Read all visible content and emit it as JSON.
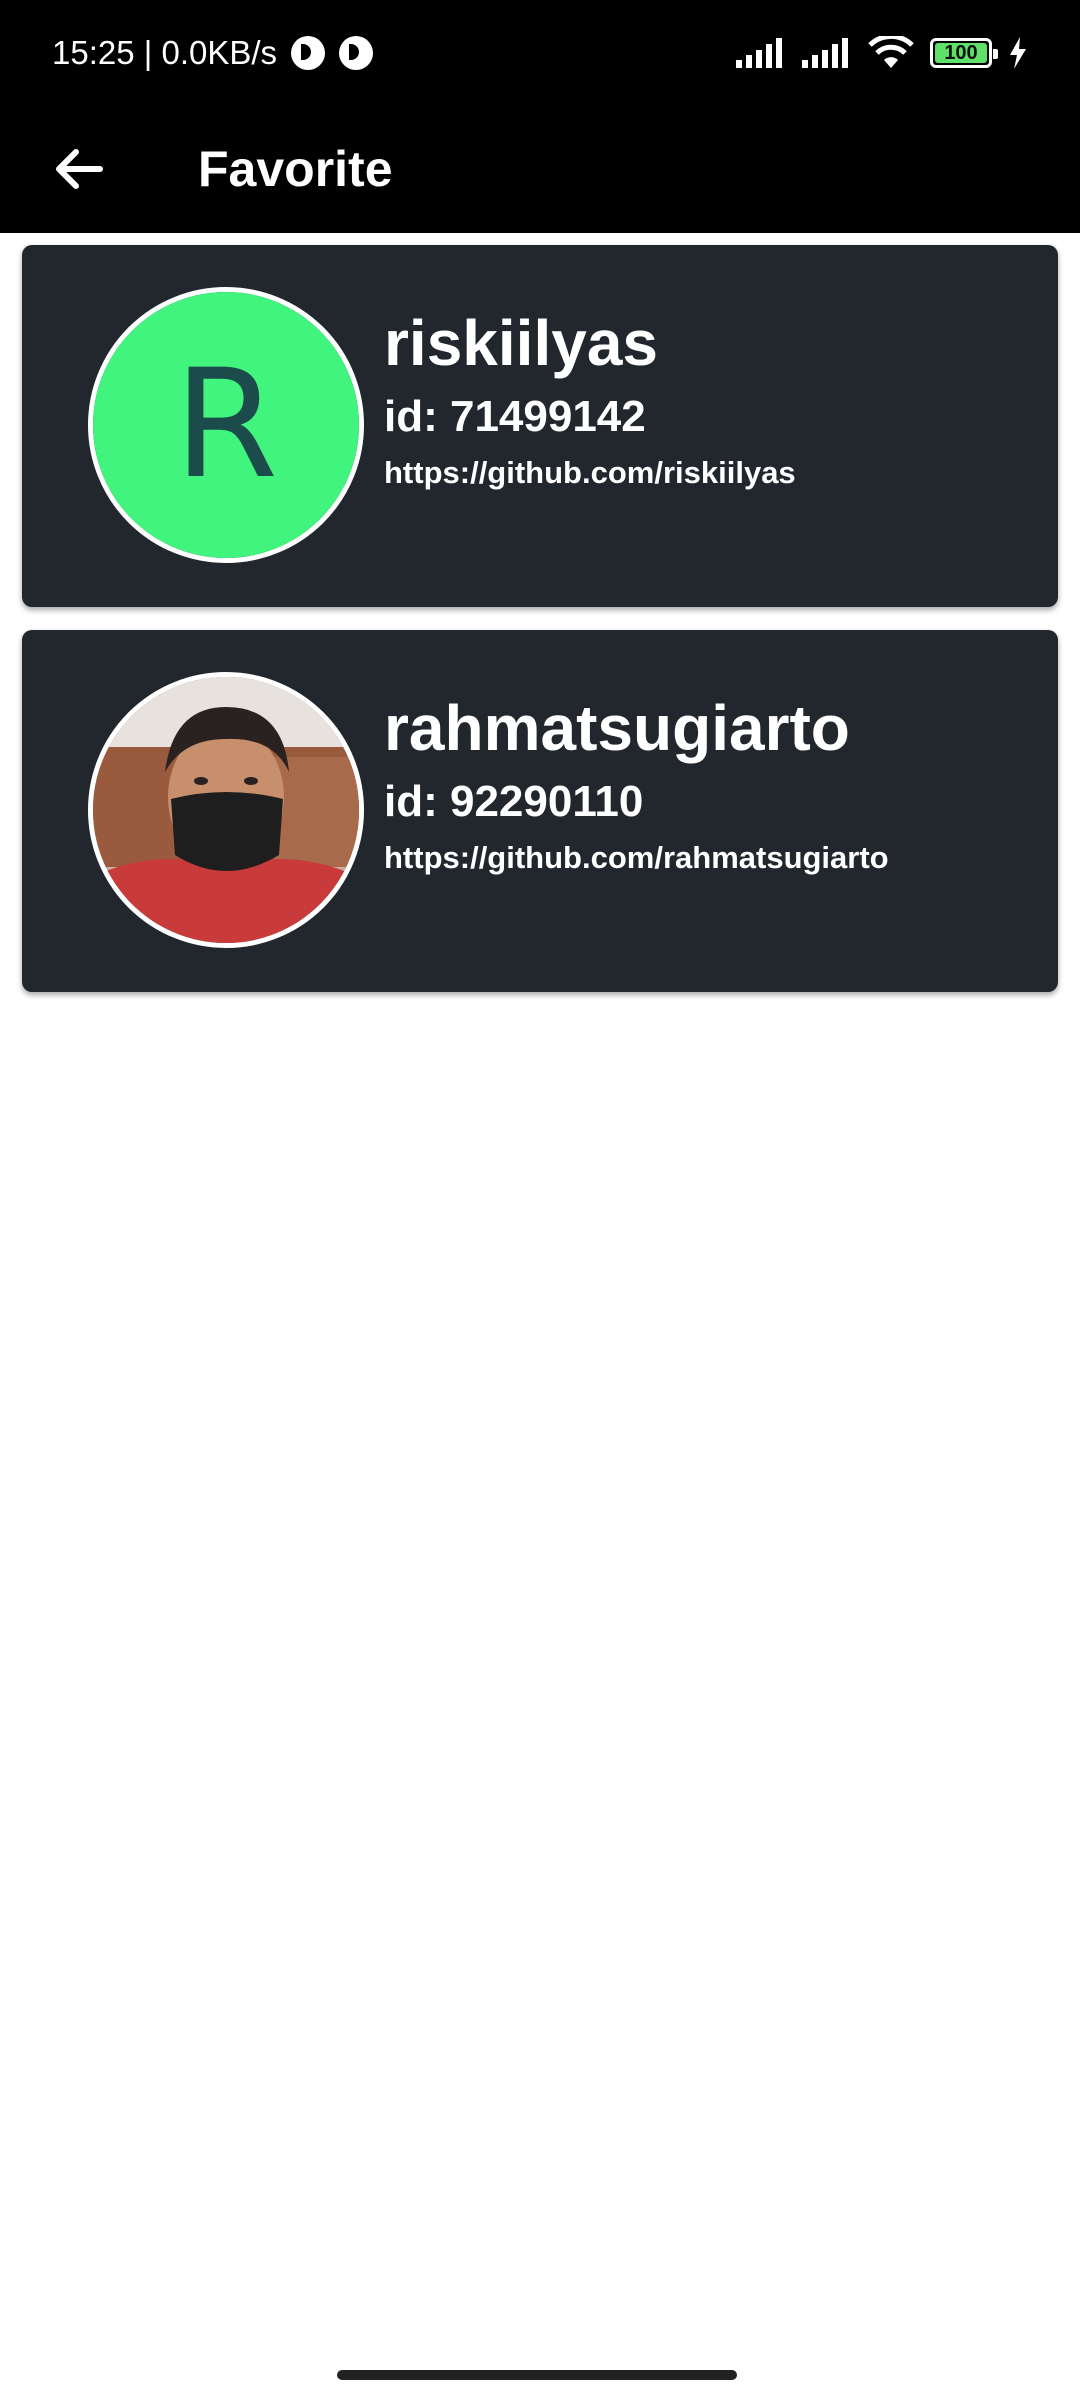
{
  "status_bar": {
    "time_speed": "15:25 | 0.0KB/s",
    "battery": "100",
    "icons": [
      "notification-icon",
      "notification-icon",
      "signal-icon",
      "signal-icon",
      "wifi-icon",
      "battery-icon",
      "charging-icon"
    ]
  },
  "app_bar": {
    "title": "Favorite",
    "back_icon": "arrow-back-icon"
  },
  "favorites": [
    {
      "avatar_type": "letter",
      "avatar_letter": "R",
      "avatar_color": "#40f47d",
      "username": "riskiilyas",
      "id": "id: 71499142",
      "url": "https://github.com/riskiilyas"
    },
    {
      "avatar_type": "photo",
      "username": "rahmatsugiarto",
      "id": "id: 92290110",
      "url": "https://github.com/rahmatsugiarto"
    }
  ],
  "colors": {
    "app_bar_bg": "#000000",
    "card_bg": "#22262d",
    "page_bg": "#ffffff",
    "avatar_green": "#40f47d"
  }
}
